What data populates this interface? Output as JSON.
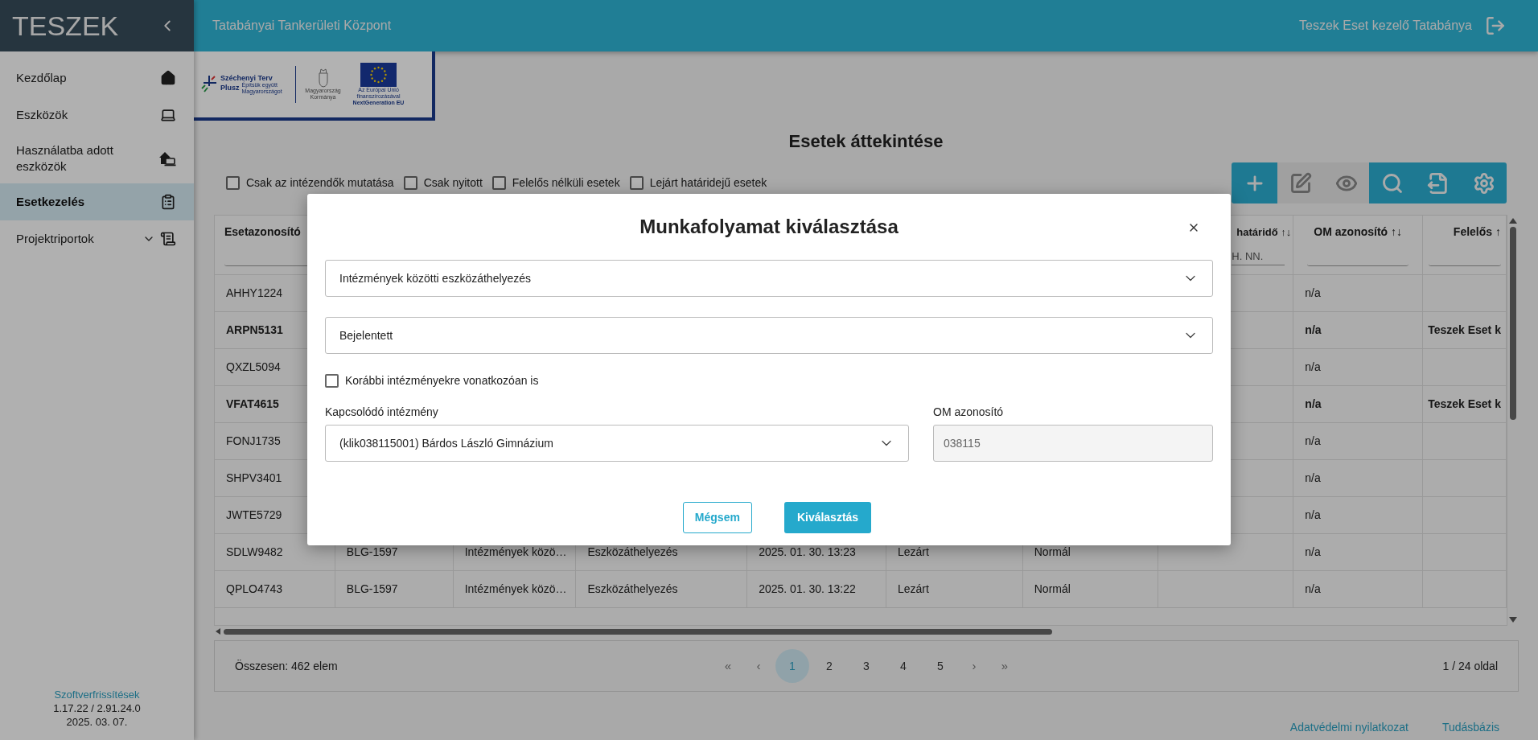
{
  "sidebar": {
    "title": "TESZEK",
    "items": [
      {
        "label": "Kezdőlap",
        "selected": false
      },
      {
        "label": "Eszközök",
        "selected": false
      },
      {
        "label": "Használatba adott eszközök",
        "selected": false
      },
      {
        "label": "Esetkezelés",
        "selected": true
      },
      {
        "label": "Projektriportok",
        "selected": false,
        "expanded": false
      }
    ],
    "update_link": "Szoftverfrissítések",
    "version": "1.17.22 / 2.91.24.0",
    "date": "2025. 03. 07."
  },
  "topbar": {
    "title": "Tatabányai Tankerületi Központ",
    "user": "Teszek Eset kezelő Tatabánya"
  },
  "banner": {
    "szechenyi_title": "Széchenyi Terv",
    "szechenyi_plus": "Plusz",
    "szechenyi_slogan": "Építsük együtt Magyarországot",
    "government": "Magyarország Kormánya",
    "eu_text": "Az Európai Unió finanszírozásával",
    "eu_program": "NextGeneration EU"
  },
  "page_title": "Esetek áttekintése",
  "filters": [
    {
      "label": "Csak az intézendők mutatása",
      "checked": false
    },
    {
      "label": "Csak nyitott",
      "checked": false
    },
    {
      "label": "Felelős nélküli esetek",
      "checked": false
    },
    {
      "label": "Lejárt határidejű esetek",
      "checked": false
    }
  ],
  "toolbar": [
    {
      "disabled": false
    },
    {
      "disabled": true
    },
    {
      "disabled": true
    },
    {
      "disabled": false
    },
    {
      "disabled": false
    },
    {
      "disabled": false
    }
  ],
  "table": {
    "columns": [
      {
        "label": "Esetazonosító",
        "filter": true
      },
      {},
      {},
      {},
      {},
      {},
      {},
      {
        "label": "határidő",
        "sort": "↑↓",
        "filter_placeholder": "H. NN."
      },
      {
        "label": "OM azonosító",
        "sort": "↑↓",
        "filter": true
      },
      {
        "label": "Felelős",
        "sort": "↑",
        "filter": true
      }
    ],
    "rows": [
      {
        "bold": false,
        "cells": [
          "AHHY1224",
          null,
          null,
          null,
          null,
          null,
          null,
          null,
          "n/a",
          null
        ]
      },
      {
        "bold": true,
        "cells": [
          "ARPN5131",
          null,
          null,
          null,
          null,
          null,
          null,
          null,
          "n/a",
          "Teszek Eset k"
        ]
      },
      {
        "bold": false,
        "cells": [
          "QXZL5094",
          null,
          null,
          null,
          null,
          null,
          null,
          null,
          "n/a",
          null
        ]
      },
      {
        "bold": true,
        "cells": [
          "VFAT4615",
          null,
          null,
          null,
          null,
          null,
          null,
          null,
          "n/a",
          "Teszek Eset k"
        ]
      },
      {
        "bold": false,
        "cells": [
          "FONJ1735",
          null,
          null,
          null,
          null,
          null,
          null,
          null,
          "n/a",
          null
        ]
      },
      {
        "bold": false,
        "cells": [
          "SHPV3401",
          null,
          null,
          null,
          null,
          null,
          null,
          null,
          "n/a",
          null
        ]
      },
      {
        "bold": false,
        "cells": [
          "JWTE5729",
          null,
          null,
          null,
          null,
          null,
          null,
          null,
          "n/a",
          null
        ]
      },
      {
        "bold": false,
        "cells": [
          "SDLW9482",
          "BLG-1597",
          "Intézmények közö…",
          "Eszközáthelyezés",
          "2025. 01. 30. 13:23",
          "Lezárt",
          "Normál",
          null,
          "n/a",
          null
        ]
      },
      {
        "bold": false,
        "cells": [
          "QPLO4743",
          "BLG-1597",
          "Intézmények közö…",
          "Eszközáthelyezés",
          "2025. 01. 30. 13:22",
          "Lezárt",
          "Normál",
          null,
          "n/a",
          null
        ]
      }
    ]
  },
  "pagination": {
    "total": "Összesen: 462 elem",
    "first": "«",
    "prev": "‹",
    "pages": [
      {
        "label": "1",
        "selected": true
      },
      {
        "label": "2",
        "selected": false
      },
      {
        "label": "3",
        "selected": false
      },
      {
        "label": "4",
        "selected": false
      },
      {
        "label": "5",
        "selected": false
      }
    ],
    "next": "›",
    "last": "»",
    "page_info": "1 / 24 oldal"
  },
  "footer_links": [
    "Adatvédelmi nyilatkozat",
    "Tudásbázis"
  ],
  "modal": {
    "title": "Munkafolyamat kiválasztása",
    "workflow": "Intézmények közötti eszközáthelyezés",
    "status": "Bejelentett",
    "previous_checkbox": {
      "label": "Korábbi intézményekre vonatkozóan is",
      "checked": false
    },
    "institution_label": "Kapcsolódó intézmény",
    "institution": "(klik038115001) Bárdos László Gimnázium",
    "om_label": "OM azonosító",
    "om_value": "038115",
    "om_disabled": true,
    "cancel": "Mégsem",
    "confirm": "Kiválasztás"
  }
}
